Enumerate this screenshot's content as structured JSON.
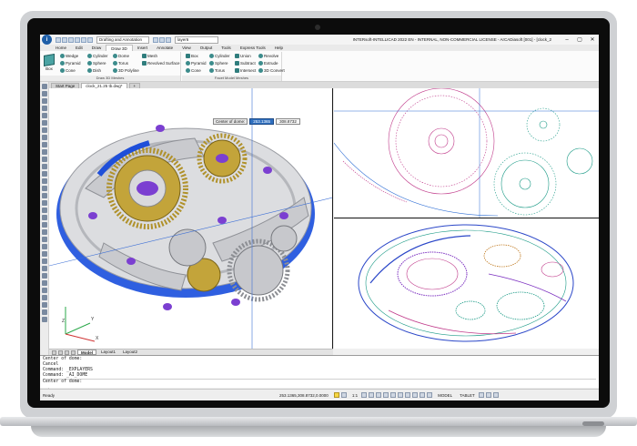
{
  "window": {
    "title": "INTERsoft-INTELLICAD 2022 EN - INTERNAL, NON-COMMERCIAL LICENSE - ArCADiasoft [001] - [clock_2",
    "workspace": "Drafting and Annotation",
    "layer": "layer6",
    "logo_letter": "i",
    "minimize": "–",
    "maximize": "▢",
    "close": "✕"
  },
  "menu_tabs": [
    "Home",
    "Edit",
    "Draw",
    "Draw 3D",
    "Insert",
    "Annotate",
    "View",
    "Output",
    "Tools",
    "Express Tools",
    "Help"
  ],
  "active_tab": "Draw 3D",
  "ribbon": {
    "group1": {
      "title": "Draw 3D Meshes",
      "box_label": "Box",
      "col1": [
        "Wedge",
        "Pyramid",
        "Cone"
      ],
      "col2": [
        "Cylinder",
        "Sphere",
        "Dish"
      ],
      "col3": [
        "Dome",
        "Torus",
        "3D Polyline"
      ],
      "col4": [
        "Mesh",
        "Revolved Surface"
      ]
    },
    "group2": {
      "title": "Facet Model Meshes",
      "col1": [
        "Box",
        "Pyramid",
        "Cone"
      ],
      "col2": [
        "Cylinder",
        "Sphere",
        "Torus"
      ],
      "col3": [
        "Union",
        "Subtract",
        "Intersect"
      ],
      "col4": [
        "Revolve",
        "Extrude",
        "3D Convert"
      ]
    }
  },
  "doc_tabs": [
    "Start Page",
    "clock_21.25 tb.dwg*"
  ],
  "doc_add": "+",
  "dynamic_input": {
    "label": "Center of dome:",
    "value1": "253.1365",
    "value2": "308.8732"
  },
  "layout_tabs": [
    "Model",
    "Layout1",
    "Layout2"
  ],
  "active_layout": "Model",
  "command_lines": [
    "Center of dome:",
    "Cancel",
    "Command: _EXPLAYERS",
    "Command: _AI_DOME"
  ],
  "command_prompt": "Center of dome:",
  "status": {
    "ready": "Ready",
    "coords": "253.1365,308.8732,0.0000",
    "scale": "1:1",
    "model": "MODEL",
    "tablet": "TABLET"
  },
  "ucs": {
    "x": "X",
    "y": "Y",
    "z": "Z"
  },
  "colors": {
    "ribbon_bg": "#fbfbfb",
    "dyn_highlight": "#2f6fbf",
    "gear_gold": "#b89a2e",
    "plate_grey": "#d7d8dc",
    "jewel_purple": "#7b3fd1",
    "blue_ring": "#1f4fd9"
  }
}
